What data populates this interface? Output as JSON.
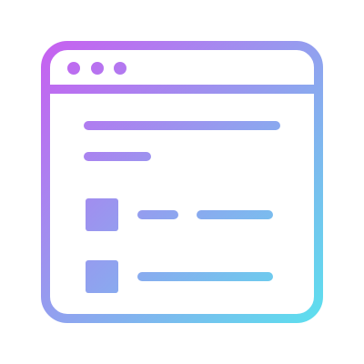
{
  "icon": {
    "name": "browser-window-icon",
    "style": "outline-gradient",
    "gradient": {
      "start": "#c85ff0",
      "end": "#5ce0ee"
    },
    "window_dots": 3,
    "text_lines": 2,
    "list_items": [
      {
        "thumbnail": true,
        "segments": 2
      },
      {
        "thumbnail": true,
        "segments": 1
      }
    ]
  }
}
